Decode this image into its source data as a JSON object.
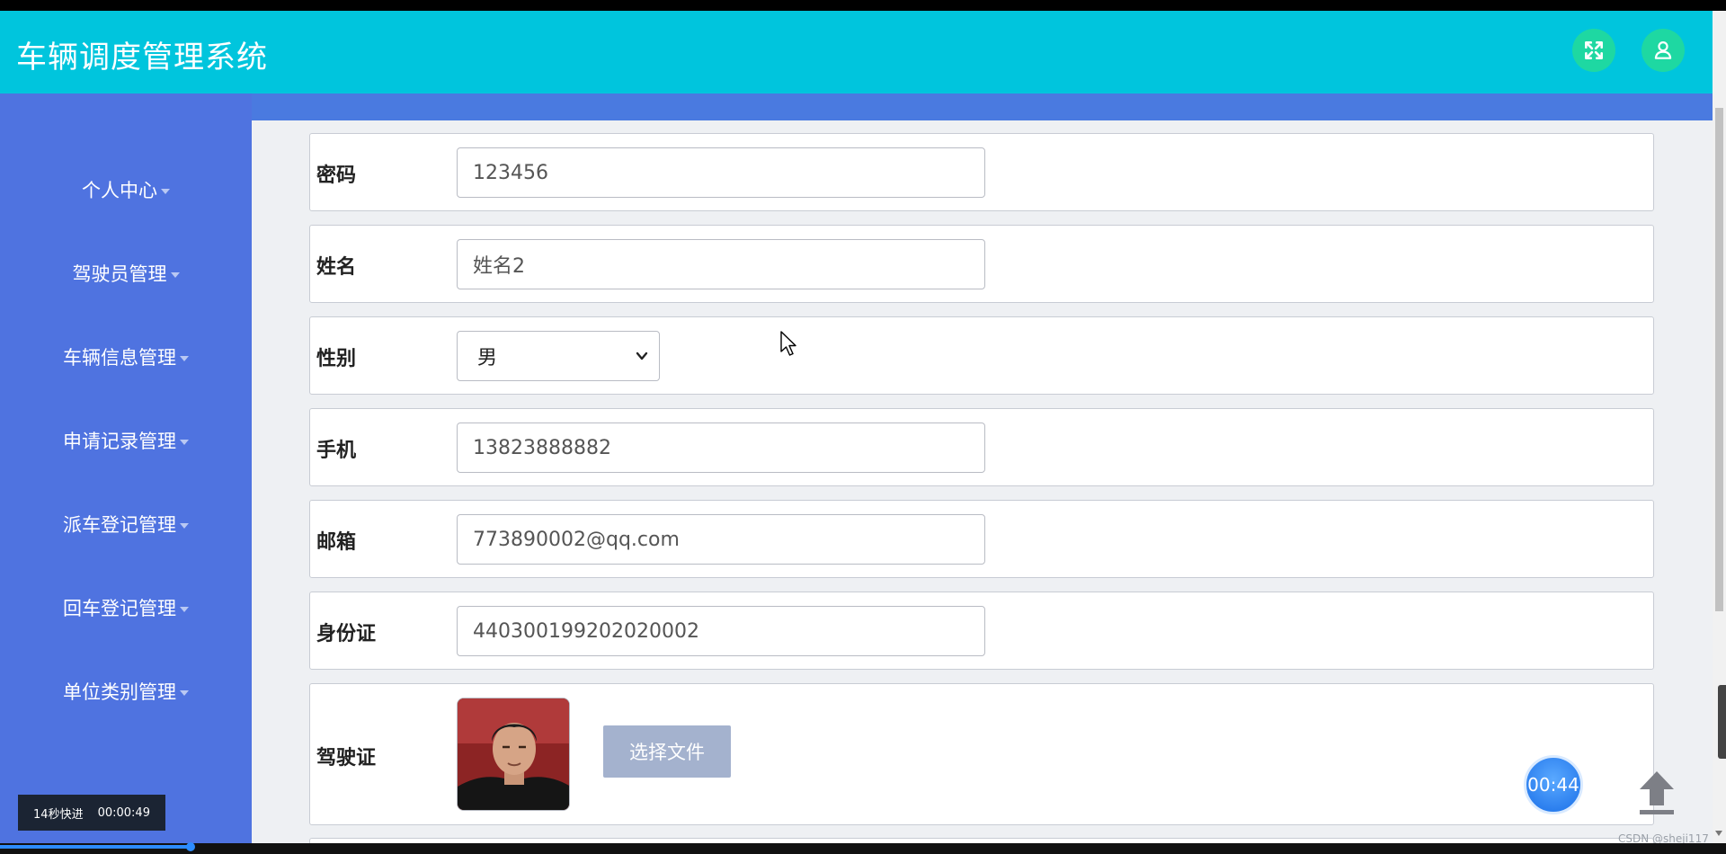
{
  "header": {
    "title": "车辆调度管理系统",
    "fullscreen_icon": "expand-icon",
    "user_icon": "user-icon",
    "accent_color": "#00c5dd",
    "button_color": "#1ed8a2"
  },
  "sidebar": {
    "color": "#4f73e0",
    "items": [
      {
        "label": "个人中心"
      },
      {
        "label": "驾驶员管理"
      },
      {
        "label": "车辆信息管理"
      },
      {
        "label": "申请记录管理"
      },
      {
        "label": "派车登记管理"
      },
      {
        "label": "回车登记管理"
      },
      {
        "label": "单位类别管理"
      }
    ]
  },
  "form": {
    "password": {
      "label": "密码",
      "value": "123456"
    },
    "name": {
      "label": "姓名",
      "value": "姓名2"
    },
    "gender": {
      "label": "性别",
      "value": "男"
    },
    "phone": {
      "label": "手机",
      "value": "13823888882"
    },
    "email": {
      "label": "邮箱",
      "value": "773890002@qq.com"
    },
    "id_card": {
      "label": "身份证",
      "value": "440300199202020002"
    },
    "license": {
      "label": "驾驶证",
      "button_label": "选择文件",
      "image_icon": "driver-photo"
    }
  },
  "overlay": {
    "timer": "00:44",
    "fast_forward_label": "14秒快进",
    "fast_forward_time": "00:00:49",
    "watermark": "CSDN @sheji117",
    "back_to_top_icon": "arrow-up-icon"
  }
}
